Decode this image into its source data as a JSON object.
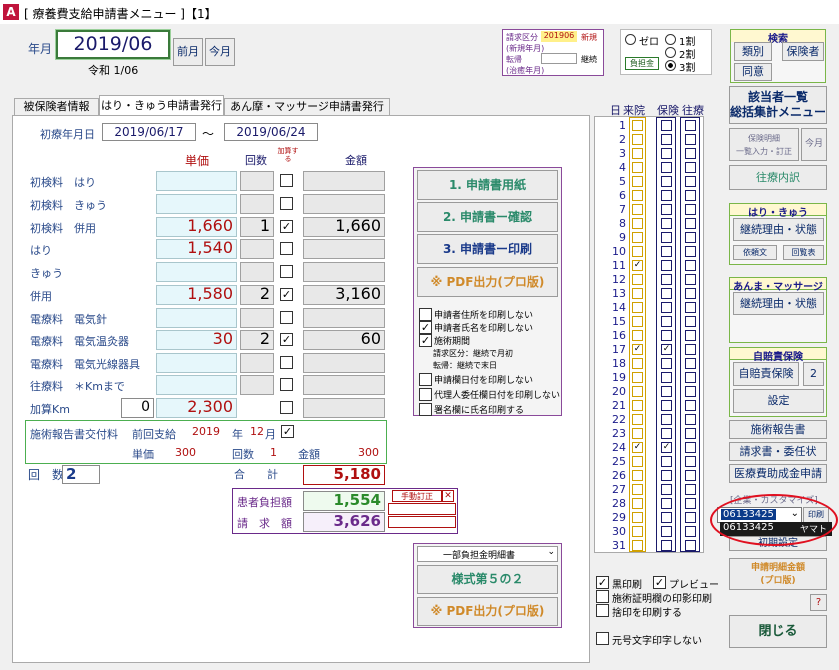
{
  "window": {
    "title": "[ 療養費支給申請書メニュー ]【1】",
    "icon": "A"
  },
  "header": {
    "label_month": "年月",
    "month": "2019/06",
    "era": "令和 1/06",
    "prev": "前月",
    "now": "今月"
  },
  "claim": {
    "kubun_label": "請求区分",
    "kubun_value": "201906",
    "shinki": "新規",
    "note1": "(新規年月)",
    "tensho_label": "転帰",
    "keizoku": "継続",
    "note2": "(治癒年月)"
  },
  "ratio": {
    "r0": "ゼロ",
    "r1": "1割",
    "r2": "2割",
    "r3": "3割",
    "burden": "負担金"
  },
  "tabs": [
    "被保険者情報",
    "はり・きゅう申請書発行",
    "あん摩・マッサージ申請書発行"
  ],
  "period": {
    "label": "初療年月日",
    "from": "2019/06/17",
    "sep": "～",
    "to": "2019/06/24"
  },
  "cols": {
    "tanka": "単価",
    "kaisu": "回数",
    "kasan": "加算する",
    "kingaku": "金額"
  },
  "rows": [
    {
      "label": "初検料　はり",
      "tanka": "",
      "kaisu": "",
      "checked": false,
      "amount": ""
    },
    {
      "label": "初検料　きゅう",
      "tanka": "",
      "kaisu": "",
      "checked": false,
      "amount": ""
    },
    {
      "label": "初検料　併用",
      "tanka": "1,660",
      "kaisu": "1",
      "checked": true,
      "amount": "1,660"
    },
    {
      "label": "はり",
      "tanka": "1,540",
      "kaisu": "",
      "checked": false,
      "amount": ""
    },
    {
      "label": "きゅう",
      "tanka": "",
      "kaisu": "",
      "checked": false,
      "amount": ""
    },
    {
      "label": "併用",
      "tanka": "1,580",
      "kaisu": "2",
      "checked": true,
      "amount": "3,160"
    },
    {
      "label": "電療料　電気針",
      "tanka": "",
      "kaisu": "",
      "checked": false,
      "amount": ""
    },
    {
      "label": "電療料　電気温灸器",
      "tanka": "30",
      "kaisu": "2",
      "checked": true,
      "amount": "60"
    },
    {
      "label": "電療料　電気光線器具",
      "tanka": "",
      "kaisu": "",
      "checked": false,
      "amount": ""
    },
    {
      "label": "往療料　＊Kmまで",
      "tanka": "",
      "kaisu": "",
      "checked": false,
      "amount": ""
    },
    {
      "label": "加算Km",
      "tanka": "2,300",
      "kaisu": "",
      "checked": false,
      "amount": "",
      "km": "0"
    }
  ],
  "report": {
    "title": "施術報告書交付料",
    "prev": "前回支給",
    "year": "2019",
    "nen": "年",
    "month": "12",
    "tsuki": "月",
    "tanka_l": "単価",
    "tanka": "300",
    "kaisu_l": "回数",
    "kaisu": "1",
    "kingaku_l": "金額",
    "kingaku": "300"
  },
  "totals": {
    "kaisu_l": "回　数",
    "kaisu": "2",
    "gokei_l": "合　　計",
    "gokei": "5,180",
    "futan_l": "患者負担額",
    "futan": "1,554",
    "teisei": "手動訂正",
    "seikyu_l": "請　求　額",
    "seikyu": "3,626"
  },
  "actions": {
    "a1": "1. 申請書用紙",
    "a2": "2. 申請書ー確認",
    "a3": "3. 申請書ー印刷",
    "a4": "※ PDF出力(プロ版)"
  },
  "options": [
    {
      "t": "申請者住所を印刷しない",
      "c": false
    },
    {
      "t": "申請者氏名を印刷しない",
      "c": true
    },
    {
      "t": "施術期間",
      "c": true
    },
    {
      "t": "申請欄日付を印刷しない",
      "c": false
    },
    {
      "t": "代理人委任欄日付を印刷しない",
      "c": false
    },
    {
      "t": "署名欄に氏名印刷する",
      "c": false
    }
  ],
  "opt_note1": "請求区分：継続で月初",
  "opt_note2": "転帰：継続で末日",
  "meisai": {
    "select": "一部負担金明細書",
    "btn": "様式第５の２",
    "pdf": "※ PDF出力(プロ版)"
  },
  "cal": {
    "h_day": "日",
    "h_visit": "来院",
    "h_hoken": "保険",
    "h_ouryo": "往療",
    "days": [
      "1",
      "2",
      "3",
      "4",
      "5",
      "6",
      "7",
      "8",
      "9",
      "10",
      "11",
      "12",
      "13",
      "14",
      "15",
      "16",
      "17",
      "18",
      "19",
      "20",
      "21",
      "22",
      "23",
      "24",
      "25",
      "26",
      "27",
      "28",
      "29",
      "30",
      "31"
    ],
    "visit": [
      11,
      17,
      24
    ],
    "hoken": [
      17,
      24
    ]
  },
  "print": {
    "black": "黒印刷",
    "preview": "プレビュー",
    "shomei": "施術証明欄の印影印刷",
    "sute": "捨印を印刷する",
    "gengo": "元号文字印字しない"
  },
  "side": {
    "kensaku": "検索",
    "shurui": "類別",
    "hokensha": "保険者",
    "doui": "同意",
    "gaito": "該当者一覧\n総括集計メニュー",
    "meisai": "保険明細\n一覧入力・訂正",
    "kongetsu": "今月",
    "ourai": "往療内訳",
    "hari_h": "はり・きゅう",
    "keizoku1": "継続理由・状態",
    "irai": "依頼文",
    "kaitou": "回覧表",
    "anma_h": "あんま・マッサージ",
    "keizoku2": "継続理由・状態",
    "jibai_h": "自賠責保険",
    "jibai": "自賠責保険",
    "jibai_n": "2",
    "settei": "設定",
    "hokoku": "施術報告書",
    "seikyusho": "請求書・委任状",
    "iryouhi": "医療費助成金申請",
    "custom": "[企業・カスタマイズ]",
    "code": "06133425",
    "insatsu": "印刷",
    "code2": "06133425",
    "yamato": "ヤマト",
    "shoki": "初期設定",
    "meisaigaku": "申請明細金額\n(プロ版)",
    "help": "?",
    "close": "閉じる"
  }
}
